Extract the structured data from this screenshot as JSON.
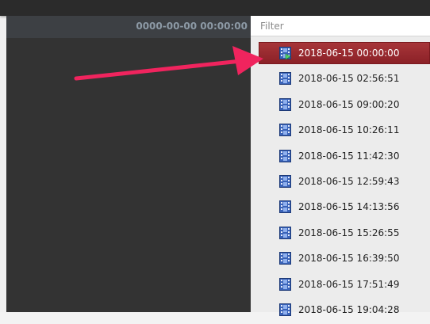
{
  "header": {
    "time_display": "0000-00-00 00:00:00"
  },
  "filter": {
    "placeholder": "Filter",
    "value": ""
  },
  "recordings": [
    {
      "label": "2018-06-15 00:00:00",
      "selected": true
    },
    {
      "label": "2018-06-15 02:56:51",
      "selected": false
    },
    {
      "label": "2018-06-15 09:00:20",
      "selected": false
    },
    {
      "label": "2018-06-15 10:26:11",
      "selected": false
    },
    {
      "label": "2018-06-15 11:42:30",
      "selected": false
    },
    {
      "label": "2018-06-15 12:59:43",
      "selected": false
    },
    {
      "label": "2018-06-15 14:13:56",
      "selected": false
    },
    {
      "label": "2018-06-15 15:26:55",
      "selected": false
    },
    {
      "label": "2018-06-15 16:39:50",
      "selected": false
    },
    {
      "label": "2018-06-15 17:51:49",
      "selected": false
    },
    {
      "label": "2018-06-15 19:04:28",
      "selected": false
    }
  ],
  "icons": {
    "item_icon": "film-icon",
    "selected_icon": "film-play-icon",
    "annotation": "pointer-arrow-icon"
  },
  "colors": {
    "selected_row": "#9a2a2f",
    "arrow": "#f0245e",
    "film_icon": "#3a63b8",
    "panel_dark": "#333333"
  }
}
